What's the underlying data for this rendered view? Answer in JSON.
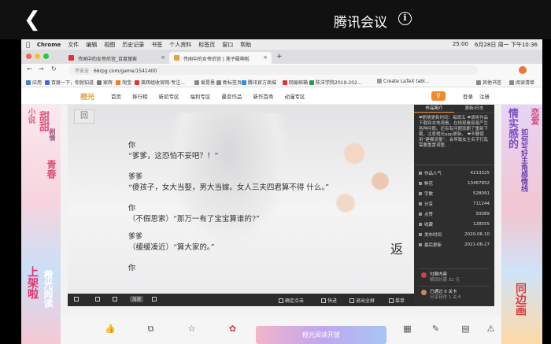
{
  "meeting": {
    "title": "腾讯会议",
    "back_icon": "chevron-left-icon",
    "info_icon": "info-icon"
  },
  "mac_menu": {
    "items": [
      "Chrome",
      "文件",
      "编辑",
      "视图",
      "历史记录",
      "书签",
      "个人资料",
      "标签页",
      "窗口",
      "帮助"
    ],
    "time": "6月28日 周一 下午10:36",
    "clock": "25:00"
  },
  "browser": {
    "tabs": [
      {
        "label": "传闻中的女帝后宫_百度搜索"
      },
      {
        "label": "传闻中的女帝后宫 | 莲子殿啊啦"
      }
    ],
    "insecure_label": "不安全",
    "url": "66rpg.com/game/1541400",
    "bookmarks": [
      "应用",
      "百度一下，你就知道",
      "家辉",
      "淘宝",
      "莱辉组收官网-专注...",
      "爱是恩",
      "新标签页",
      "腾讯官方商城",
      "网易邮箱",
      "陈洋学院2019-202...",
      "Create LaTeX tabl...",
      "其他书签",
      "阅读清单"
    ]
  },
  "site": {
    "logo": "橙光",
    "nav": [
      "首页",
      "排行榜",
      "新初专区",
      "福利专区",
      "最变作品",
      "新作首秀",
      "动漫专区"
    ],
    "login": "登录",
    "register": "注册"
  },
  "game": {
    "back_badge": "回",
    "dialogue": [
      {
        "speaker": "你",
        "text": "“爹爹，这恐怕不妥吧？！”"
      },
      {
        "speaker": "爹爹",
        "text": "“傻孩子，女大当娶，男大当嫁。女人三夫四君算不得  什么。”"
      },
      {
        "speaker": "你",
        "text": "（不假思索）“那万一有了宝宝算谁的?”"
      },
      {
        "speaker": "爹爹",
        "text": "（缓缓凑近）“算大家的。”"
      },
      {
        "speaker": "你",
        "text": ""
      }
    ],
    "corner_mark": "返",
    "controls": {
      "speed": "加速",
      "confirm": "确定点击",
      "fast": "快进",
      "fullscreen": "退出全屏",
      "menu": "菜单"
    }
  },
  "panel": {
    "tabs": [
      "作品简介",
      "更新/日志"
    ],
    "notice": "❤剧情更新时间：每周五 ❤请将作品下载到本地观看，在线观看容易产生各种问题。还有有问题就删了重新下载，注意橙光app更新。 ❤不要使用“建模流量”，会导致女主名字打乱需要重置调整…",
    "stats": [
      {
        "label": "作品人气",
        "value": "4213325"
      },
      {
        "label": "鲜花",
        "value": "13467852"
      },
      {
        "label": "字数",
        "value": "528091"
      },
      {
        "label": "分享",
        "value": "711244"
      },
      {
        "label": "点赞",
        "value": "50089"
      },
      {
        "label": "收藏",
        "value": "128555"
      },
      {
        "label": "发布时间",
        "value": "2020-06-10"
      },
      {
        "label": "最后更新",
        "value": "2021-06-27"
      }
    ],
    "pay_title": "付费内容",
    "pay_sub": "解锁共需 32 元",
    "gate_title": "已通过 0 关卡",
    "gate_sub": "分享获得 1 关卡"
  },
  "side_left": {
    "lines": [
      "小说",
      "甜甜",
      "剧情",
      "青春",
      "上架啦",
      "橙光阅读"
    ]
  },
  "side_right": {
    "lines": [
      "情实感的",
      "如何写好主角感情线",
      "恋爱",
      "同边画"
    ]
  },
  "bottom": {
    "banner": "橙光阅读开放"
  }
}
